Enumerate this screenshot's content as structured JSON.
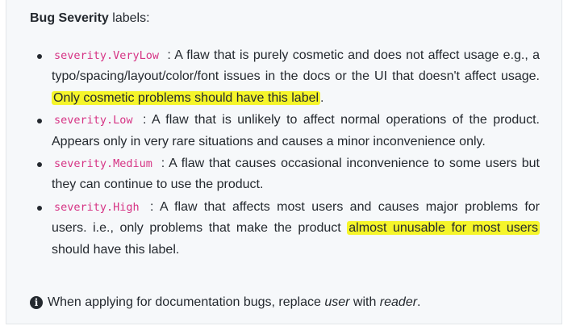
{
  "heading": {
    "bold": "Bug Severity",
    "rest": " labels:"
  },
  "items": [
    {
      "label": "severity.VeryLow",
      "text_before": " : A flaw that is purely cosmetic and does not affect usage e.g., a typo/spacing/layout/color/font issues in the docs or the UI that doesn't affect usage. ",
      "highlight": "Only cosmetic problems should have this label",
      "text_after": "."
    },
    {
      "label": "severity.Low",
      "text_before": " : A flaw that is unlikely to affect normal operations of the product. Appears only in very rare situations and causes a minor inconvenience only.",
      "highlight": "",
      "text_after": ""
    },
    {
      "label": "severity.Medium",
      "text_before": " : A flaw that causes occasional inconvenience to some users but they can continue to use the product.",
      "highlight": "",
      "text_after": ""
    },
    {
      "label": "severity.High",
      "text_before": " : A flaw that affects most users and causes major problems for users. i.e., only problems that make the product ",
      "highlight": "almost unusable for most users",
      "text_after": " should have this label."
    }
  ],
  "note": {
    "icon": "info-icon",
    "before": "When applying for documentation bugs, replace ",
    "em1": "user",
    "middle": " with ",
    "em2": "reader",
    "after": "."
  },
  "colors": {
    "label_text": "#d63384",
    "highlight": "#f5f52a",
    "panel_bg": "#f6f8fa"
  }
}
